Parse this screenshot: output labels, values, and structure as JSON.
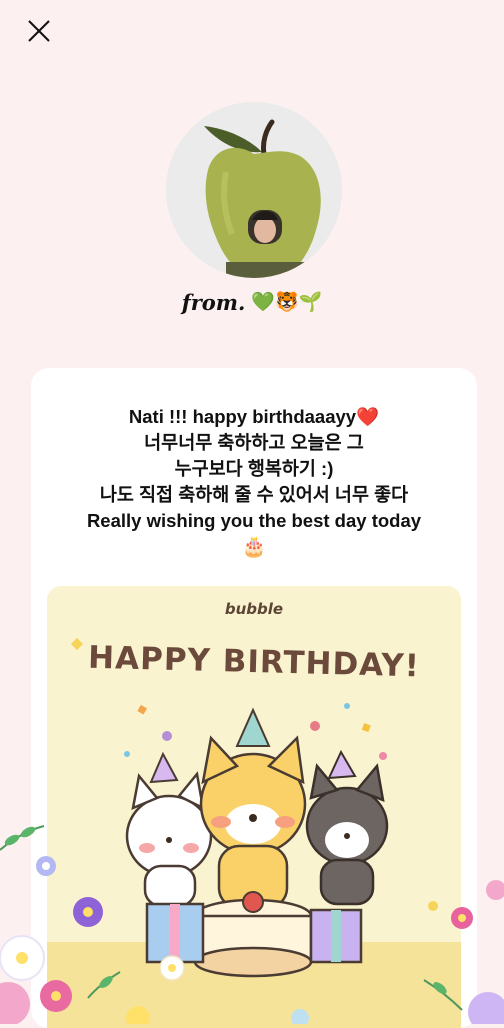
{
  "header": {
    "close_icon": "close-icon"
  },
  "sender": {
    "prefix": "from.",
    "emojis": "💚🐯🌱"
  },
  "message": {
    "lines": [
      "Nati !!! happy birthdaaayy❤️",
      "너무너무 축하하고 오늘은 그",
      "누구보다 행복하기 :)",
      "나도 직접 축하해 줄 수 있어서 너무 좋다",
      "Really wishing you the best day today"
    ],
    "emoji": "🎂"
  },
  "birthday_card": {
    "brand": "bubble",
    "title": "HAPPY BIRTHDAY!"
  },
  "colors": {
    "background": "#fcf0f0",
    "card": "#ffffff",
    "birthday_card_bg": "#faf3cf",
    "title": "#6b4a3c"
  }
}
